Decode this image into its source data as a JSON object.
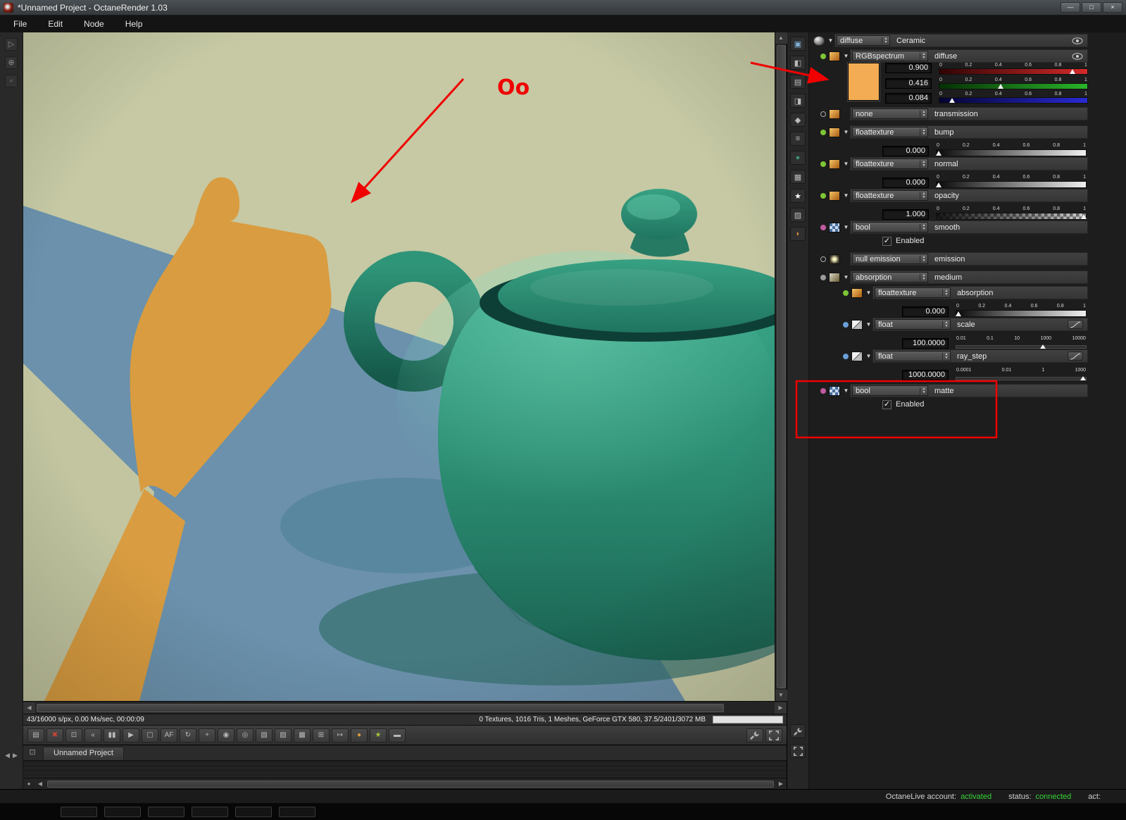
{
  "window": {
    "title": "*Unnamed Project - OctaneRender 1.03",
    "controls": [
      {
        "name": "minimize-button",
        "glyph": "—"
      },
      {
        "name": "maximize-button",
        "glyph": "□"
      },
      {
        "name": "close-button",
        "glyph": "×"
      }
    ]
  },
  "menu": {
    "items": [
      {
        "name": "menu-file",
        "label": "File"
      },
      {
        "name": "menu-edit",
        "label": "Edit"
      },
      {
        "name": "menu-node",
        "label": "Node"
      },
      {
        "name": "menu-help",
        "label": "Help"
      }
    ]
  },
  "viewport": {
    "status_left": "43/16000 s/px, 0.00 Ms/sec, 00:00:09",
    "status_right": "0 Textures, 1016 Tris, 1 Meshes, GeForce GTX 580, 37.5/2401/3072 MB"
  },
  "toolbar": {
    "buttons": [
      {
        "name": "save-image-icon",
        "glyph": "▤"
      },
      {
        "name": "stop-render-icon",
        "glyph": "✖",
        "color": "#cc4433"
      },
      {
        "name": "fit-viewport-icon",
        "glyph": "⊡"
      },
      {
        "name": "restart-render-icon",
        "glyph": "«"
      },
      {
        "name": "pause-render-icon",
        "glyph": "▮▮"
      },
      {
        "name": "resume-render-icon",
        "glyph": "▶"
      },
      {
        "name": "display-mode-icon",
        "glyph": "▢"
      },
      {
        "name": "af-lock-icon",
        "glyph": "AF"
      },
      {
        "name": "refresh-icon",
        "glyph": "↻"
      },
      {
        "name": "focus-pick-icon",
        "glyph": "+"
      },
      {
        "name": "whitebalance-pick-icon",
        "glyph": "◉"
      },
      {
        "name": "material-pick-icon",
        "glyph": "◎"
      },
      {
        "name": "region-render-icon",
        "glyph": "▧"
      },
      {
        "name": "alpha-checker-icon",
        "glyph": "▨"
      },
      {
        "name": "subsample-icon",
        "glyph": "▩"
      },
      {
        "name": "clay-mode-icon",
        "glyph": "⊞"
      },
      {
        "name": "copy-render-icon",
        "glyph": "↦"
      },
      {
        "name": "material-ball-icon",
        "glyph": "●",
        "color": "#d99a3c"
      },
      {
        "name": "daylight-icon",
        "glyph": "★",
        "color": "#a4c23c"
      },
      {
        "name": "export-icon",
        "glyph": "▬"
      }
    ]
  },
  "side_icons": [
    {
      "name": "render-target-icon",
      "glyph": "▣",
      "color": "#7fb2d8"
    },
    {
      "name": "camera-icon",
      "glyph": "◧"
    },
    {
      "name": "environment-icon",
      "glyph": "▤"
    },
    {
      "name": "imager-icon",
      "glyph": "◨"
    },
    {
      "name": "kernel-icon",
      "glyph": "◆"
    },
    {
      "name": "layers-icon",
      "glyph": "≡"
    },
    {
      "name": "medium-icon",
      "glyph": "●",
      "color": "#3d8f78"
    },
    {
      "name": "texture-image-icon",
      "glyph": "▦"
    },
    {
      "name": "emission-icon",
      "glyph": "★",
      "color": "#ffffff"
    },
    {
      "name": "checker-texture-icon",
      "glyph": "▨"
    },
    {
      "name": "paint-material-icon",
      "glyph": "◗",
      "color": "#d98a3c"
    }
  ],
  "left_icons": [
    {
      "name": "select-tool-icon",
      "glyph": "▷"
    },
    {
      "name": "pan-tool-icon",
      "glyph": "⊕"
    },
    {
      "name": "outliner-icon",
      "glyph": "▫"
    }
  ],
  "node_panel": {
    "ticks01": [
      "0",
      "0.2",
      "0.4",
      "0.6",
      "0.8",
      "1"
    ],
    "root": {
      "type": "diffuse",
      "name": "Ceramic"
    },
    "diffuse": {
      "type": "RGBspectrum",
      "name": "diffuse",
      "swatch": "#f3ac53",
      "r": "0.900",
      "g": "0.416",
      "b": "0.084"
    },
    "transmission": {
      "type": "none",
      "name": "transmission"
    },
    "bump": {
      "type": "floattexture",
      "name": "bump",
      "value": "0.000"
    },
    "normal": {
      "type": "floattexture",
      "name": "normal",
      "value": "0.000"
    },
    "opacity": {
      "type": "floattexture",
      "name": "opacity",
      "value": "1.000"
    },
    "smooth": {
      "type": "bool",
      "name": "smooth",
      "checkbox": "Enabled"
    },
    "emission": {
      "type": "null emission",
      "name": "emission"
    },
    "medium": {
      "type": "absorption",
      "name": "medium"
    },
    "absorption": {
      "type": "floattexture",
      "name": "absorption",
      "value": "0.000"
    },
    "scale": {
      "type": "float",
      "name": "scale",
      "value": "100.0000",
      "ticks": [
        "0.01",
        "0.1",
        "10",
        "1000",
        "10000"
      ]
    },
    "ray_step": {
      "type": "float",
      "name": "ray_step",
      "value": "1000.0000",
      "ticks": [
        "0.0001",
        "0.01",
        "1",
        "1000"
      ]
    },
    "matte": {
      "type": "bool",
      "name": "matte",
      "checkbox": "Enabled"
    }
  },
  "graph": {
    "tab": "Unnamed Project"
  },
  "footer": {
    "account_label": "OctaneLive account:",
    "account_value": "activated",
    "status_label": "status:",
    "status_value": "connected",
    "act_label": "act:"
  },
  "annotations": {
    "callout": "Oo"
  },
  "colors": {
    "annotation_red": "#f00000",
    "swatch_orange": "#f3ac53",
    "status_green": "#35d435",
    "teapot_teal": "#2a8a70",
    "floor_blue": "#6b91ac",
    "shadow_orange": "#d99c40",
    "backdrop_olive": "#c6c9a4"
  }
}
